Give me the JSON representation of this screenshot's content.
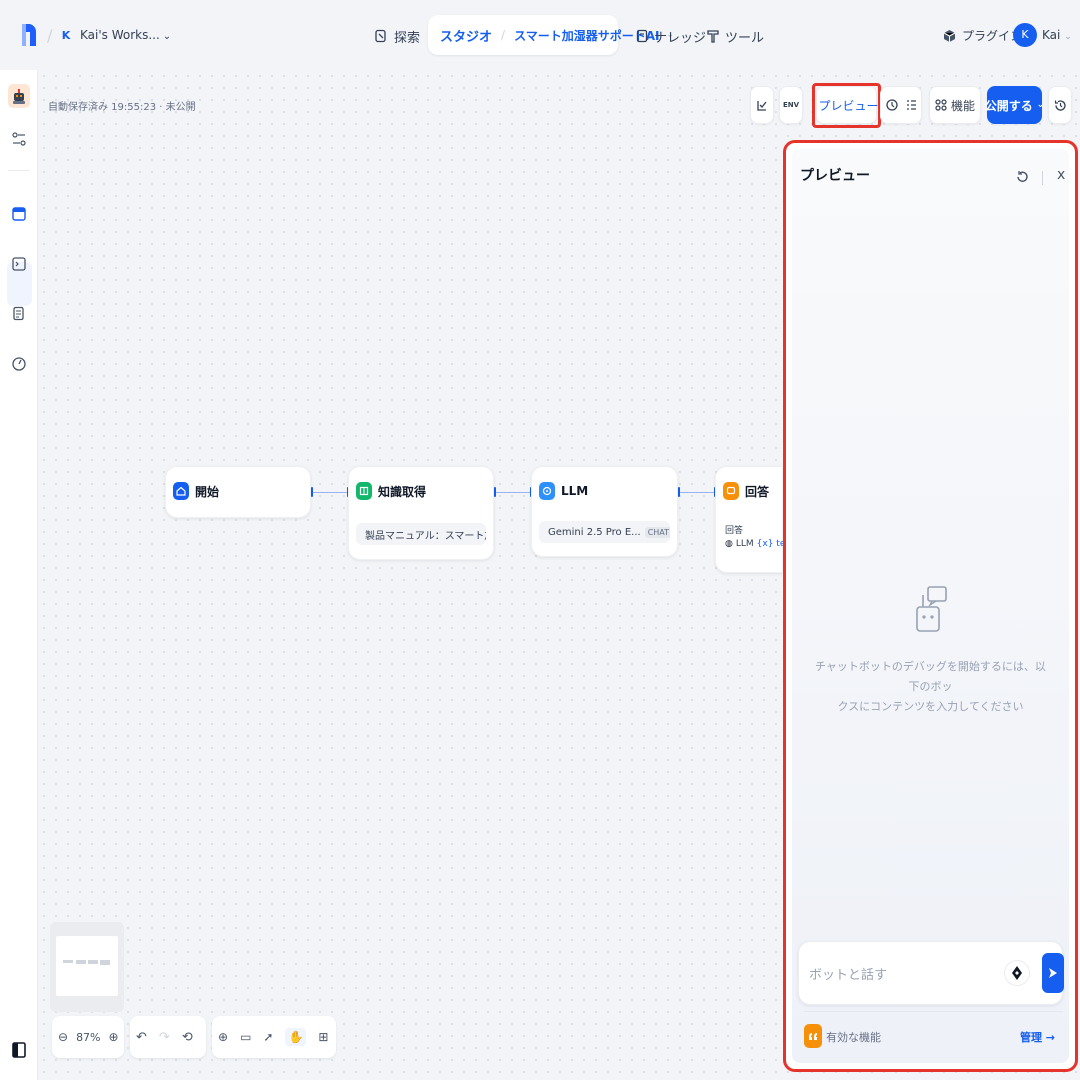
{
  "header": {
    "workspace_badge": "K",
    "workspace_name": "Kai's Works...",
    "workspace_chevron": "⌄",
    "nav": {
      "explore": "探索",
      "studio": "スタジオ",
      "app_name": "スマート加湿器サポートAI",
      "knowledge": "ナレッジ",
      "tools": "ツール"
    },
    "plugins": "プラグイン",
    "user_initial": "K",
    "user_name": "Kai",
    "user_chevron": "⌄"
  },
  "toolbar": {
    "autosave": "自動保存済み 19:55:23 · 未公開",
    "env_label": "ENV",
    "preview_label": "プレビュー",
    "features_label": "機能",
    "publish_label": "公開する"
  },
  "nodes": {
    "start": {
      "title": "開始"
    },
    "knowledge": {
      "title": "知識取得",
      "detail": "製品マニュアル：スマート加湿器 SH..."
    },
    "llm": {
      "title": "LLM",
      "model": "Gemini 2.5 Pro E...",
      "mode": "CHAT"
    },
    "answer": {
      "title": "回答",
      "label": "回答",
      "ref_node": "LLM",
      "ref_var": "{x} text"
    }
  },
  "zoom": {
    "level": "87%"
  },
  "preview": {
    "title": "プレビュー",
    "close": "x",
    "hint_line1": "チャットボットのデバッグを開始するには、以下のボッ",
    "hint_line2": "クスにコンテンツを入力してください",
    "input_placeholder": "ボットと話す",
    "features_label": "有効な機能",
    "manage_label": "管理 →"
  },
  "colors": {
    "accent": "#155eef",
    "highlight": "#e5342b",
    "start_node": "#155eef",
    "knowledge_node": "#12b76a",
    "llm_node": "#2e90fa",
    "answer_node": "#f79009"
  }
}
